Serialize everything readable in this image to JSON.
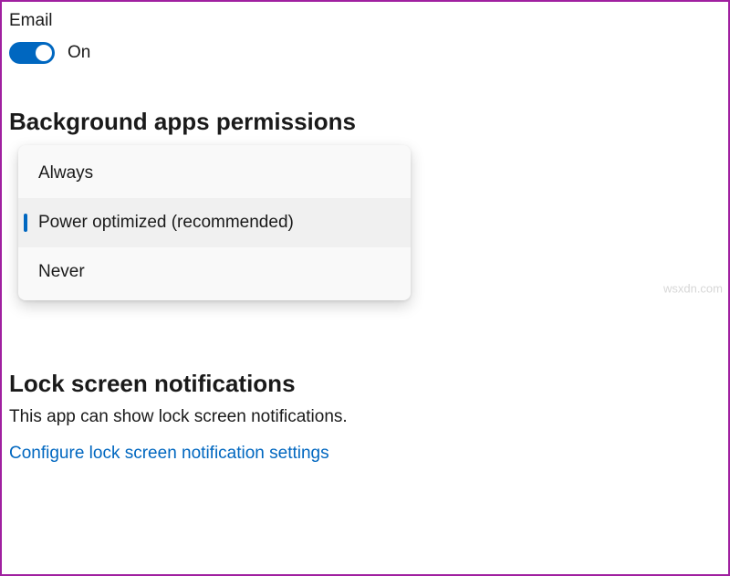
{
  "email": {
    "label": "Email",
    "toggle_state": "On"
  },
  "background": {
    "heading": "Background apps permissions",
    "options": {
      "0": "Always",
      "1": "Power optimized (recommended)",
      "2": "Never"
    }
  },
  "lockscreen": {
    "heading": "Lock screen notifications",
    "description": "This app can show lock screen notifications.",
    "link": "Configure lock screen notification settings"
  },
  "watermark": "wsxdn.com"
}
